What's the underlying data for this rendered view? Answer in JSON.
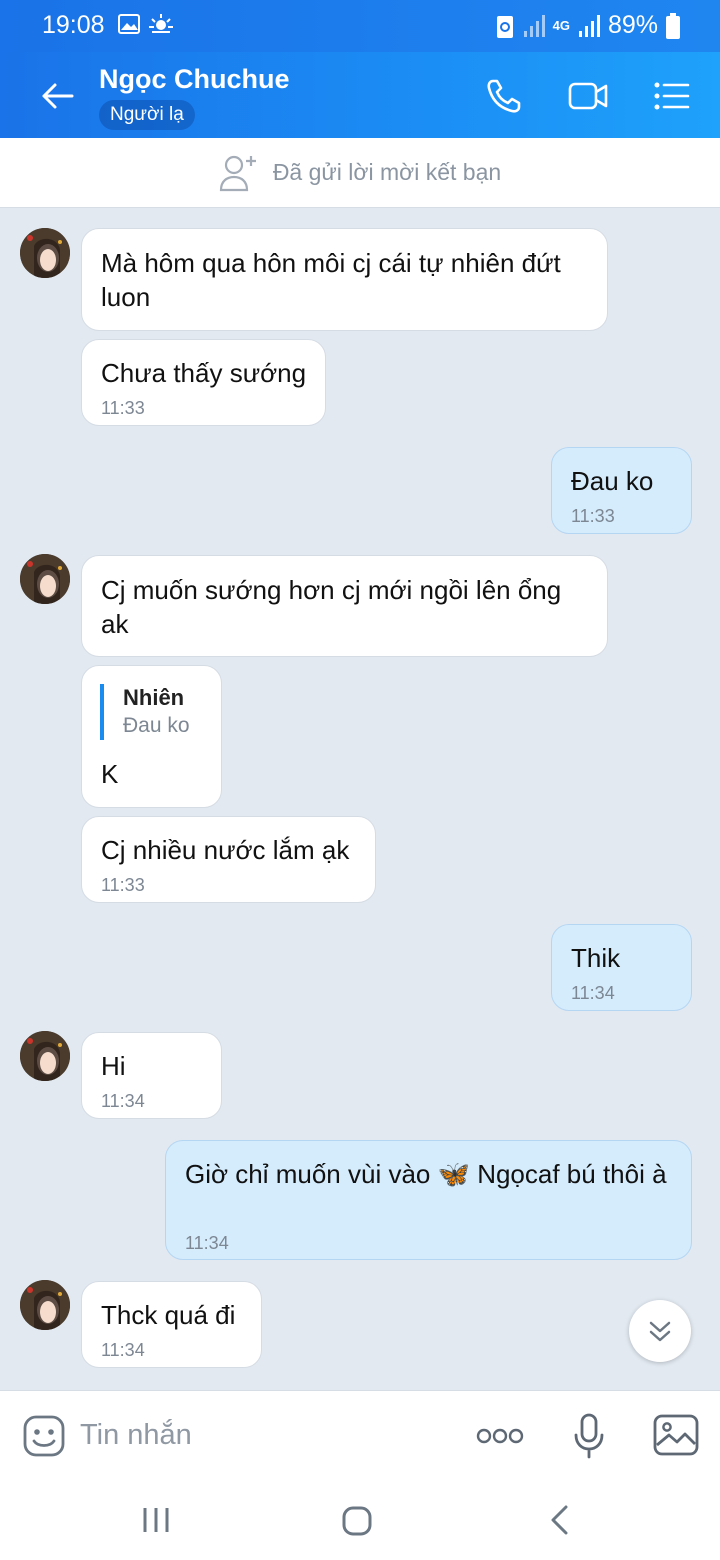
{
  "status_bar": {
    "time": "19:08",
    "battery": "89%",
    "network": "4G"
  },
  "header": {
    "title": "Ngọc Chuchue",
    "badge": "Người lạ"
  },
  "friend_request": {
    "label": "Đã gửi lời mời kết bạn"
  },
  "messages": [
    {
      "from": "them",
      "text": "Mà hôm qua hôn môi cj cái tự nhiên đứt luon"
    },
    {
      "from": "them",
      "text": "Chưa thấy sướng",
      "time": "11:33"
    },
    {
      "from": "me",
      "text": "Đau ko",
      "time": "11:33"
    },
    {
      "from": "them",
      "text": "Cj muốn sướng hơn cj mới ngồi lên ổng ak"
    },
    {
      "from": "them",
      "reply_to_name": "Nhiên",
      "reply_to_text": "Đau ko",
      "text": "K"
    },
    {
      "from": "them",
      "text": "Cj nhiều nước lắm ạk",
      "time": "11:33"
    },
    {
      "from": "me",
      "text": "Thik",
      "time": "11:34"
    },
    {
      "from": "them",
      "text": "Hi",
      "time": "11:34"
    },
    {
      "from": "me",
      "text": "Giờ chỉ muốn vùi vào 🦋 Ngọcaf bú thôi à",
      "time": "11:34"
    },
    {
      "from": "them",
      "text": "Thck quá đi",
      "time": "11:34"
    }
  ],
  "input": {
    "placeholder": "Tin nhắn"
  },
  "colors": {
    "header": "#1a73e8",
    "incoming": "#ffffff",
    "outgoing": "#d5ecfd",
    "background": "#e2e9f1",
    "reply_bar": "#1a8cf0"
  },
  "icons": [
    "back-arrow-icon",
    "phone-icon",
    "video-call-icon",
    "menu-list-icon",
    "add-friend-icon",
    "emoji-icon",
    "more-dots-icon",
    "microphone-icon",
    "image-icon",
    "chevron-double-down-icon"
  ]
}
